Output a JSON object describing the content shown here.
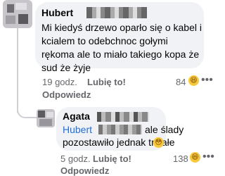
{
  "comment": {
    "author": "Hubert",
    "lines": [
      "Mi kiedyś drzewo oparło się o kabel i",
      "kcialem to odebchnoc gołymi",
      "rękoma  ale to miało takiego kopa że",
      "sud że żyje"
    ],
    "time": "19 godz.",
    "like_label": "Lubię to!",
    "reply_label": "Odpowiedz",
    "reaction_count": "84",
    "reaction_emoji": "😆",
    "more_menu": "•••"
  },
  "reply": {
    "author": "Agata",
    "mention": "Hubert",
    "text_line1": "ale ślady",
    "text_line2": "pozostawiło jednak trwałe",
    "text_emoji": "😳",
    "time": "5 godz.",
    "like_label": "Lubię to!",
    "reply_label": "Odpowiedz",
    "reaction_count": "138",
    "reaction_emoji": "😆",
    "more_menu": "•••"
  }
}
